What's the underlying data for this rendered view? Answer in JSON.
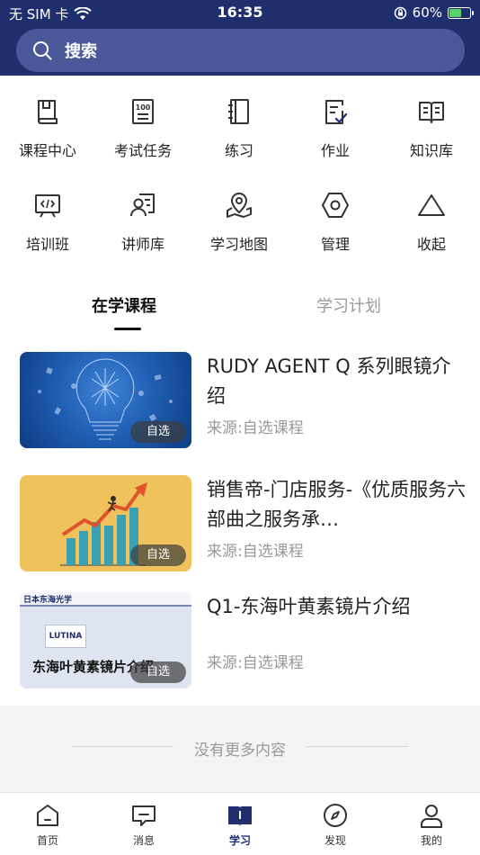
{
  "status_bar": {
    "carrier": "无 SIM 卡",
    "time": "16:35",
    "battery": "60%",
    "battery_level": 0.6
  },
  "search": {
    "label": "搜索"
  },
  "grid": {
    "items": [
      {
        "label": "课程中心",
        "icon": "book-icon"
      },
      {
        "label": "考试任务",
        "icon": "exam-icon"
      },
      {
        "label": "练习",
        "icon": "notebook-icon"
      },
      {
        "label": "作业",
        "icon": "homework-icon"
      },
      {
        "label": "知识库",
        "icon": "knowledge-icon"
      },
      {
        "label": "培训班",
        "icon": "training-icon"
      },
      {
        "label": "讲师库",
        "icon": "lecturer-icon"
      },
      {
        "label": "学习地图",
        "icon": "map-icon"
      },
      {
        "label": "管理",
        "icon": "hexagon-icon"
      },
      {
        "label": "收起",
        "icon": "triangle-icon"
      }
    ]
  },
  "tabs": {
    "active": "在学课程",
    "inactive": "学习计划"
  },
  "courses": [
    {
      "title": "RUDY AGENT Q 系列眼镜介绍",
      "source": "来源:自选课程",
      "tag": "自选"
    },
    {
      "title": "销售帝-门店服务-《优质服务六部曲之服务承…",
      "source": "来源:自选课程",
      "tag": "自选"
    },
    {
      "title": "Q1-东海叶黄素镜片介绍",
      "source": "来源:自选课程",
      "tag": "自选",
      "thumb_header": "日本东海光学",
      "thumb_brand": "LUTINA",
      "thumb_caption": "东海叶黄素镜片介绍"
    }
  ],
  "footer": {
    "no_more": "没有更多内容"
  },
  "bottom_nav": {
    "items": [
      {
        "label": "首页",
        "icon": "home-icon"
      },
      {
        "label": "消息",
        "icon": "message-icon"
      },
      {
        "label": "学习",
        "icon": "study-icon"
      },
      {
        "label": "发现",
        "icon": "compass-icon"
      },
      {
        "label": "我的",
        "icon": "profile-icon"
      }
    ]
  },
  "colors": {
    "header_bg": "#1f2f6e",
    "search_bg": "#4a5799",
    "active_nav": "#1f2f6e"
  }
}
